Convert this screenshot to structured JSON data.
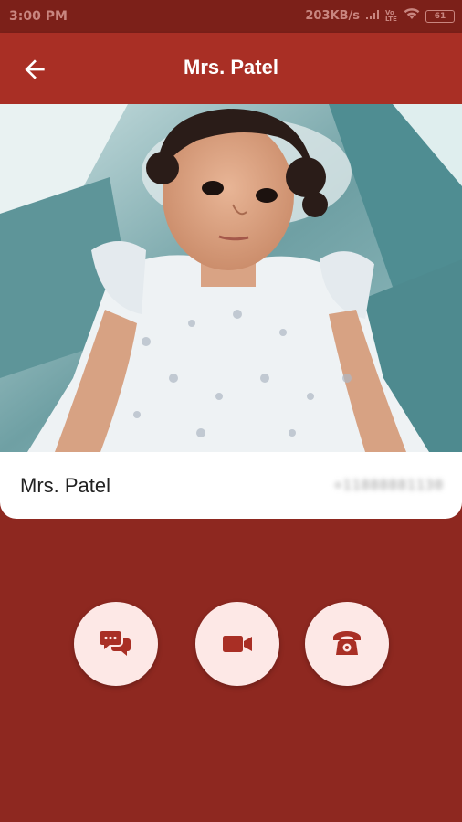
{
  "status_bar": {
    "time": "3:00 PM",
    "network_speed": "203KB/s",
    "network_type": "VoLTE",
    "battery_level": "61",
    "icons": [
      "signal-icon",
      "wifi-icon",
      "battery-icon"
    ]
  },
  "app_bar": {
    "title": "Mrs. Patel",
    "back_icon": "arrow-left-icon"
  },
  "contact": {
    "name": "Mrs. Patel",
    "number": "+11888881130"
  },
  "actions": [
    {
      "name": "message-button",
      "icon": "chat-bubbles-icon"
    },
    {
      "name": "video-call-button",
      "icon": "video-camera-icon"
    },
    {
      "name": "voice-call-button",
      "icon": "telephone-icon"
    }
  ],
  "colors": {
    "primary": "#a92f25",
    "background": "#8e2820",
    "button_fill": "#fde8e6",
    "icon": "#a92f25"
  }
}
